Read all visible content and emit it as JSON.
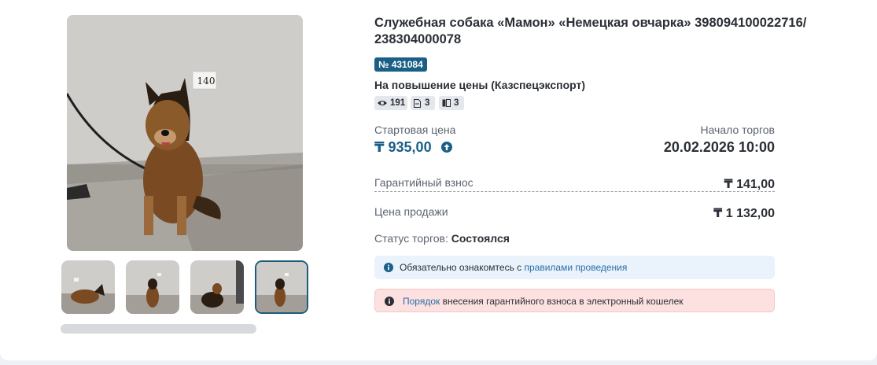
{
  "lot": {
    "title": "Служебная собака «Мамон» «Немецкая овчарка» 398094100022716/ 238304000078",
    "number_badge": "№ 431084",
    "auction_type": "На повышение цены (Казспецэкспорт)",
    "stats": [
      {
        "icon": "eye-icon",
        "value": "191"
      },
      {
        "icon": "document-icon",
        "value": "3"
      },
      {
        "icon": "book-icon",
        "value": "3"
      }
    ]
  },
  "prices": {
    "start_label": "Стартовая цена",
    "start_value": "₸ 935,00",
    "start_icon": "arrow-up-circle-icon",
    "begin_label": "Начало торгов",
    "begin_value": "20.02.2026 10:00",
    "guarantee_label": "Гарантийный взнос",
    "guarantee_value": "₸ 141,00",
    "sale_label": "Цена продажи",
    "sale_value": "₸ 1 132,00"
  },
  "status": {
    "label": "Статус торгов:",
    "value": "Состоялся"
  },
  "notices": {
    "info_text": "Обязательно ознакомтесь с ",
    "info_link": "правилами проведения",
    "warn_link": "Порядок",
    "warn_text": " внесения гарантийного взноса в электронный кошелек"
  },
  "gallery": {
    "main_label": "140",
    "thumb_count": 4,
    "active_thumb": 4
  },
  "colors": {
    "accent": "#1a5f86",
    "link": "#2a6ea8",
    "info_bg": "#eaf2fb",
    "warn_bg": "#fde0e0"
  }
}
